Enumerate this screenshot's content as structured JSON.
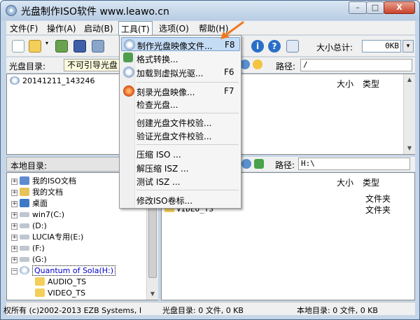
{
  "window": {
    "title": "光盘制作ISO软件 www.leawo.cn",
    "min_label": "–",
    "max_label": "□",
    "close_label": "X"
  },
  "menubar": {
    "items": [
      {
        "label": "文件(F)"
      },
      {
        "label": "操作(A)"
      },
      {
        "label": "启动(B)"
      },
      {
        "label": "工具(T)"
      },
      {
        "label": "选项(O)"
      },
      {
        "label": "帮助(H)"
      }
    ]
  },
  "toolbar": {
    "size_label": "大小总计:",
    "size_value": "0KB",
    "size_drop": "▾"
  },
  "disc_pane": {
    "label": "光盘目录:",
    "path_value": "不可引导光盘",
    "right_path_label": "路径:",
    "right_path_value": "/",
    "tree_item": "20141211_143246",
    "col_size": "大小",
    "col_type": "类型"
  },
  "local_pane": {
    "label": "本地目录:",
    "right_path_label": "路径:",
    "right_path_value": "H:\\",
    "col_size": "大小",
    "col_type": "类型",
    "tree": [
      {
        "label": "我的ISO文档"
      },
      {
        "label": "我的文档"
      },
      {
        "label": "桌面"
      },
      {
        "label": "win7(C:)"
      },
      {
        "label": "(D:)"
      },
      {
        "label": "LUCIA专用(E:)"
      },
      {
        "label": "(F:)"
      },
      {
        "label": "(G:)"
      },
      {
        "label": "Quantum of Sola(H:)"
      },
      {
        "label": "AUDIO_TS"
      },
      {
        "label": "VIDEO_TS"
      }
    ],
    "list": [
      {
        "name": "",
        "type": "文件夹"
      },
      {
        "name": "VIDEO_TS",
        "type": "文件夹"
      }
    ]
  },
  "tools_menu": {
    "items": [
      {
        "label": "制作光盘映像文件...",
        "key": "F8"
      },
      {
        "label": "格式转换...",
        "key": ""
      },
      {
        "label": "加载到虚拟光驱...",
        "key": "F6"
      },
      {
        "label": "刻录光盘映像...",
        "key": "F7"
      },
      {
        "label": "检查光盘...",
        "key": ""
      },
      {
        "label": "创建光盘文件校验...",
        "key": ""
      },
      {
        "label": "验证光盘文件校验...",
        "key": ""
      },
      {
        "label": "压缩 ISO ...",
        "key": ""
      },
      {
        "label": "解压缩 ISZ ...",
        "key": ""
      },
      {
        "label": "测试 ISZ ...",
        "key": ""
      },
      {
        "label": "修改ISO卷标...",
        "key": ""
      }
    ]
  },
  "statusbar": {
    "copyright": "权所有 (c)2002-2013 EZB Systems, I",
    "disc_status": "光盘目录: 0 文件, 0 KB",
    "local_status": "本地目录: 0 文件, 0 KB"
  },
  "colors": {
    "accent_highlight": "#c5dcf5",
    "arrow": "#f07820",
    "title_bg": "#c5d6e8"
  }
}
